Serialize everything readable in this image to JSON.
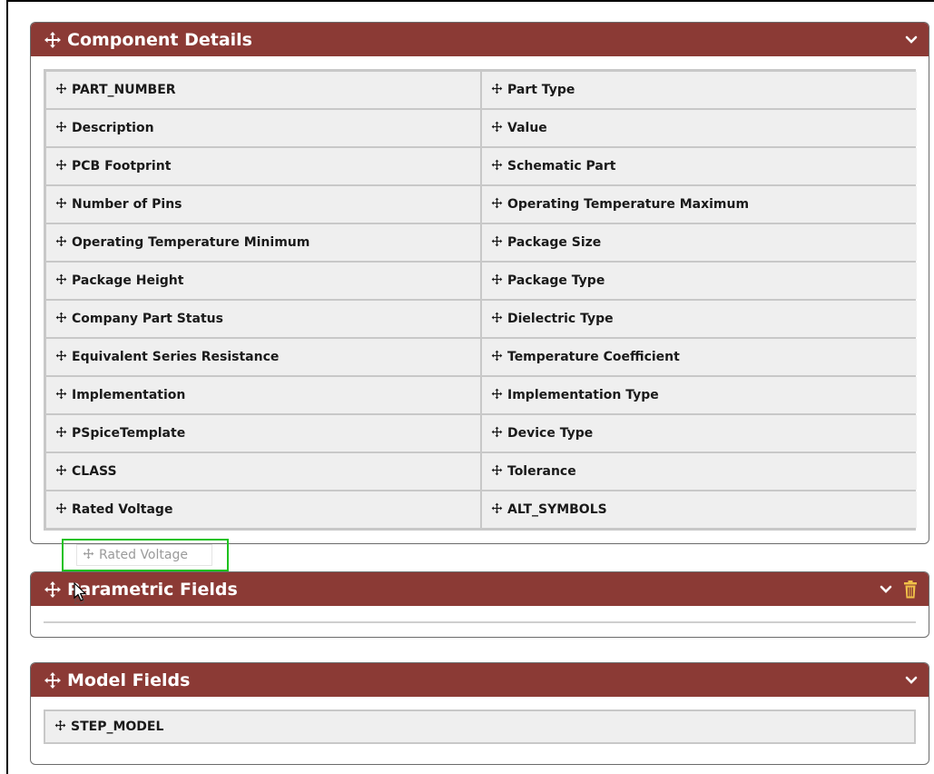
{
  "panels": {
    "component_details": {
      "title": "Component Details",
      "fields": [
        [
          "PART_NUMBER",
          "Part Type"
        ],
        [
          "Description",
          "Value"
        ],
        [
          "PCB Footprint",
          "Schematic Part"
        ],
        [
          "Number of Pins",
          "Operating Temperature Maximum"
        ],
        [
          "Operating Temperature Minimum",
          "Package Size"
        ],
        [
          "Package Height",
          "Package Type"
        ],
        [
          "Company Part Status",
          "Dielectric Type"
        ],
        [
          "Equivalent Series Resistance",
          "Temperature Coefficient"
        ],
        [
          "Implementation",
          "Implementation Type"
        ],
        [
          "PSpiceTemplate",
          "Device Type"
        ],
        [
          "CLASS",
          "Tolerance"
        ],
        [
          "Rated Voltage",
          "ALT_SYMBOLS"
        ]
      ]
    },
    "parametric_fields": {
      "title": "Parametric Fields"
    },
    "model_fields": {
      "title": "Model Fields",
      "fields": [
        "STEP_MODEL"
      ]
    }
  },
  "drag_ghost": {
    "label": "Rated Voltage"
  },
  "icons": {
    "move": "move-arrows-icon",
    "collapse": "chevron-down-icon",
    "delete": "trash-icon",
    "cursor": "mouse-pointer-icon"
  },
  "colors": {
    "header": "#8b3a35",
    "header_text": "#ffffff",
    "cell_bg": "#efefef",
    "drop_highlight": "#1ec21e",
    "trash": "#f0c048"
  }
}
